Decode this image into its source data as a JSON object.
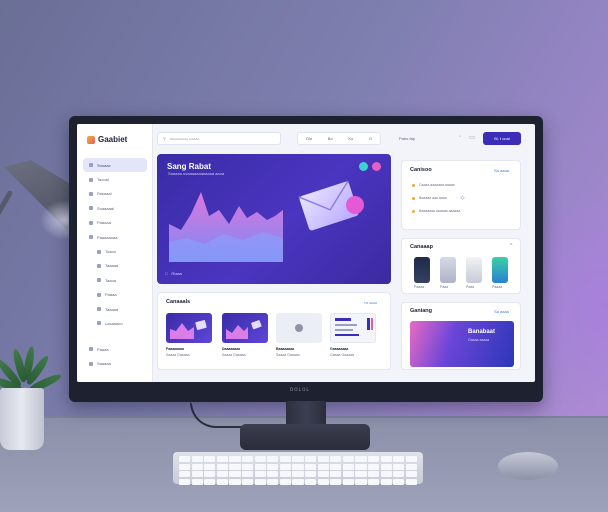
{
  "scene": {
    "monitor_brand": "ᴅᴏʟᴏʟ"
  },
  "app": {
    "logo_text": "Gaabiet",
    "search_placeholder": "ᴋᴀᴀᴀᴀᴏᴀᴀᴀ ᴏᴀᴀᴀᴀ",
    "pill_items": [
      "Olo",
      "Bo",
      "Ko",
      "O"
    ],
    "top_label": "Pabo  fap",
    "cta_label": "Bl. f  ooal"
  },
  "sidebar": {
    "items": [
      {
        "label": "Snoaac",
        "active": true
      },
      {
        "label": "Taooal"
      },
      {
        "label": "Pasaaal"
      },
      {
        "label": "Soaaaaal"
      },
      {
        "label": "Paaoaa"
      },
      {
        "label": "Paaaaaoaa"
      },
      {
        "label": "Toaoo"
      },
      {
        "label": "Taaaaa"
      },
      {
        "label": "Taaoa"
      },
      {
        "label": "Paaaa"
      },
      {
        "label": "Taaaaa"
      },
      {
        "label": "Lacaaaoo"
      }
    ],
    "footer": [
      {
        "label": "Paaaa"
      },
      {
        "label": "Saaaaa"
      }
    ]
  },
  "hero": {
    "title": "Sang Rabat",
    "subtitle": "Saaaaa ooaaaaaaaaaaaa aaoa",
    "footer_label": "Rlaaa",
    "dot_colors": [
      "#3fd0d0",
      "#e45fc2"
    ]
  },
  "projects": {
    "title": "Canaaals",
    "link": "ᴛᴏ ᴀᴀᴀᴀ",
    "cards": [
      {
        "title": "Paaaaaaaa",
        "meta": "Saaaa  Gaaaaa"
      },
      {
        "title": "Daaaaaaaa",
        "meta": "Saaaa  Gaaaaa"
      },
      {
        "title": "Baaaaaaaa",
        "meta": "Saaaa  Gaaaaa"
      },
      {
        "title": "Gaaaaaaaa",
        "meta": "Gaaaa  Gaaaaa"
      }
    ]
  },
  "right_panel_1": {
    "title": "Canisoo",
    "link": "Sa aaaa",
    "rows": [
      {
        "text": "Caaaa aaaaaaa aaaaa"
      },
      {
        "text": "Baaaaa aaa aaaa"
      },
      {
        "text": "Baaaaaaa aaaaaa aaaaaa"
      }
    ]
  },
  "right_panel_2": {
    "title": "Canaaap",
    "labels": [
      "Paaaa",
      "Paaa",
      "Paaa",
      "Paaaa"
    ]
  },
  "right_panel_3": {
    "title": "Ganiang",
    "link": "Sa aaaa",
    "card_title": "Banabaat",
    "card_sub": "Oaaaa aaaaa"
  }
}
